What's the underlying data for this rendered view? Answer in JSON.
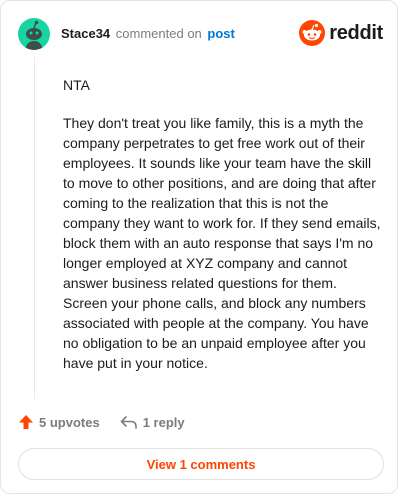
{
  "header": {
    "username": "Stace34",
    "commented_text": "commented on",
    "post_link": "post"
  },
  "brand": {
    "wordmark": "reddit",
    "logo_icon": "reddit-snoo-icon",
    "color": "#ff4500"
  },
  "avatar": {
    "icon": "snoo-avatar-icon",
    "color": "#18d3a2"
  },
  "comment": {
    "paragraphs": [
      "NTA",
      "They don't treat you like family, this is a myth the company perpetrates to get free work out of their employees. It sounds like your team have the skill to move to other positions, and are doing that after coming to the realization that this is not the company they want to work for. If they send emails, block them with an auto response that says I'm no longer employed at XYZ company and cannot answer business related questions for them. Screen your phone calls, and block any numbers associated with people at the company. You have no obligation to be an unpaid employee after you have put in your notice."
    ]
  },
  "actions": {
    "upvotes_label": "5 upvotes",
    "upvote_icon": "upvote-arrow-icon",
    "reply_label": "1 reply",
    "reply_icon": "reply-arrow-icon"
  },
  "view_comments": {
    "label": "View 1 comments"
  },
  "colors": {
    "accent": "#ff4500",
    "link": "#0079d3",
    "muted": "#7c7c7c"
  }
}
